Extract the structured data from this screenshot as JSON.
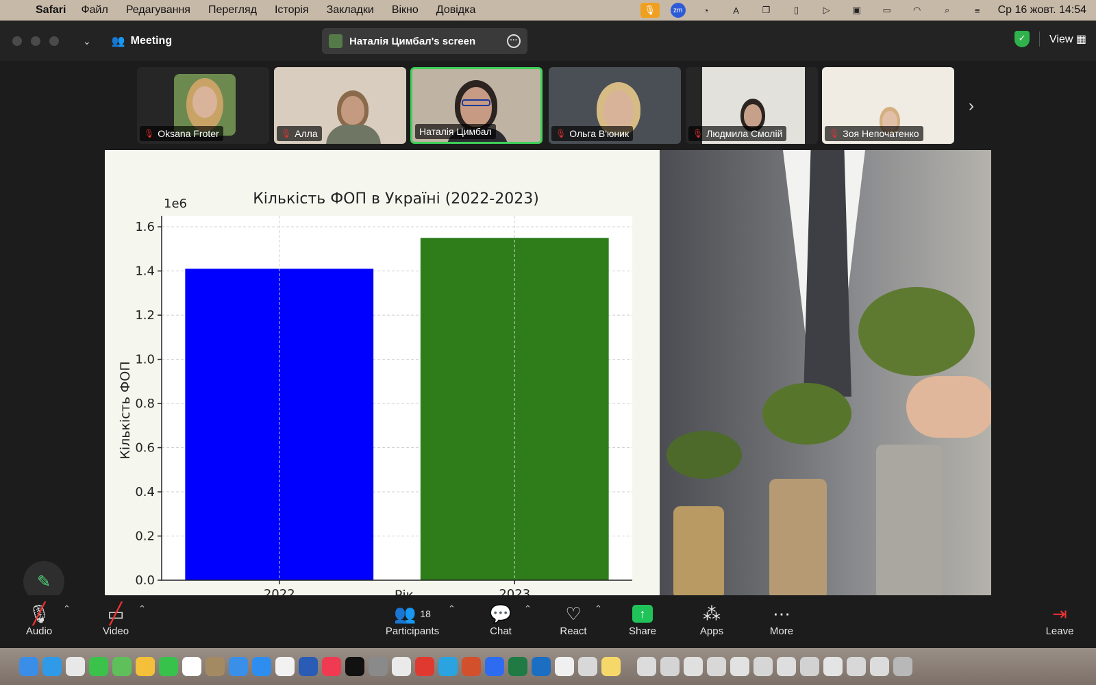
{
  "menubar": {
    "app": "Safari",
    "items": [
      "Файл",
      "Редагування",
      "Перегляд",
      "Історія",
      "Закладки",
      "Вікно",
      "Довідка"
    ],
    "clock": "Ср 16 жовт.  14:54",
    "zoom_badge": "zm",
    "notif_count": "21"
  },
  "window": {
    "meeting_label": "Meeting",
    "screen_label": "Наталія Цимбал's screen",
    "view_label": "View"
  },
  "participants": [
    {
      "name": "Oksana Froter",
      "bg": "#6c8a4f",
      "skin": "#d9b49a",
      "hair": "#c9a266"
    },
    {
      "name": "Алла",
      "bg": "#d8cdbf",
      "skin": "#c49a80",
      "hair": "#8a6a4a"
    },
    {
      "name": "Наталія Цимбал",
      "bg": "#bfb3a3",
      "skin": "#c69a83",
      "hair": "#2b2420"
    },
    {
      "name": "Ольга В'юник",
      "bg": "#4a4f55",
      "skin": "#d8b399",
      "hair": "#d6bb84"
    },
    {
      "name": "Людмила Смолій",
      "bg": "#e3e1dc",
      "skin": "#c7a08a",
      "hair": "#2c2420"
    },
    {
      "name": "Зоя Непочатенко",
      "bg": "#f0ebe3",
      "skin": "#e2c0a8",
      "hair": "#d4b080"
    }
  ],
  "chart_data": {
    "type": "bar",
    "title": "Кількість ФОП в Україні (2022-2023)",
    "xlabel": "Рік",
    "ylabel": "Кількість ФОП",
    "offset_label": "1e6",
    "categories": [
      "2022",
      "2023"
    ],
    "values": [
      1410000,
      1550000
    ],
    "colors": [
      "#0000ff",
      "#2e7d1a"
    ],
    "ylim": [
      0,
      1650000
    ],
    "yticks": [
      "0.0",
      "0.2",
      "0.4",
      "0.6",
      "0.8",
      "1.0",
      "1.2",
      "1.4",
      "1.6"
    ],
    "grid": true
  },
  "toolbar": {
    "audio": "Audio",
    "video": "Video",
    "participants": "Participants",
    "participants_count": "18",
    "chat": "Chat",
    "react": "React",
    "share": "Share",
    "apps": "Apps",
    "more": "More",
    "leave": "Leave"
  }
}
